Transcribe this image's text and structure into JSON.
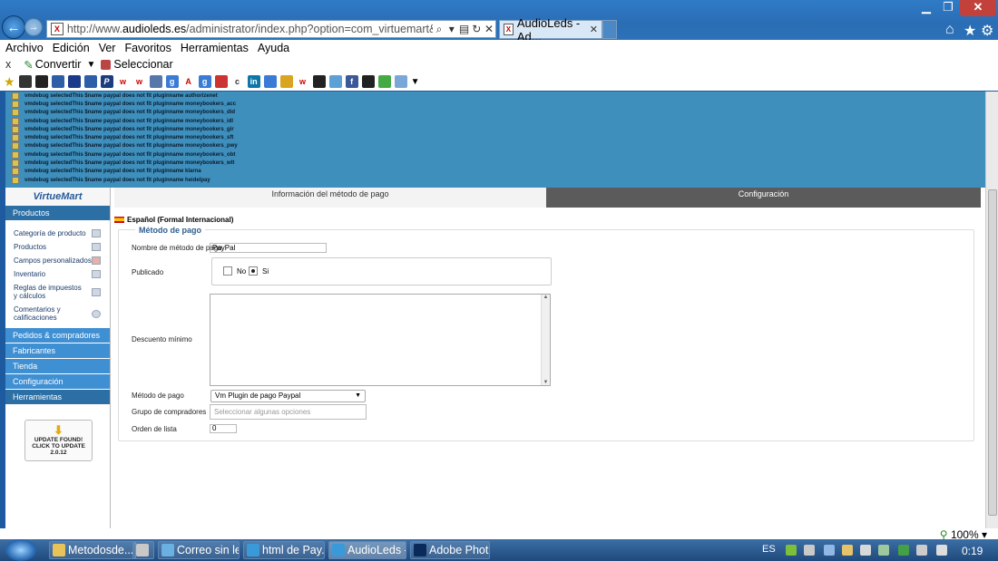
{
  "browser": {
    "url_prefix": "http://www.",
    "url_domain": "audioleds.es",
    "url_rest": "/administrator/index.php?option=com_virtuemart&view=paymen",
    "tab_title": "AudioLeds - Ad...",
    "favicon": "X"
  },
  "menubar": [
    "Archivo",
    "Edición",
    "Ver",
    "Favoritos",
    "Herramientas",
    "Ayuda"
  ],
  "cmdbar": {
    "close": "x",
    "convert": "Convertir",
    "select": "Seleccionar"
  },
  "debug_lines": [
    "vmdebug selectedThis $name paypal does not fit pluginname authorizenet",
    "vmdebug selectedThis $name paypal does not fit pluginname moneybookers_acc",
    "vmdebug selectedThis $name paypal does not fit pluginname moneybookers_did",
    "vmdebug selectedThis $name paypal does not fit pluginname moneybookers_idl",
    "vmdebug selectedThis $name paypal does not fit pluginname moneybookers_gir",
    "vmdebug selectedThis $name paypal does not fit pluginname moneybookers_sft",
    "vmdebug selectedThis $name paypal does not fit pluginname moneybookers_pwy",
    "vmdebug selectedThis $name paypal does not fit pluginname moneybookers_obt",
    "vmdebug selectedThis $name paypal does not fit pluginname moneybookers_wlt",
    "vmdebug selectedThis $name paypal does not fit pluginname klarna",
    "vmdebug selectedThis $name paypal does not fit pluginname heidelpay"
  ],
  "sidebar": {
    "logo": "VirtueMart",
    "products_header": "Productos",
    "items": [
      "Categoría de producto",
      "Productos",
      "Campos personalizados",
      "Inventario",
      "Reglas de impuestos y cálculos",
      "Comentarios y calificaciones"
    ],
    "sections": [
      "Pedidos & compradores",
      "Fabricantes",
      "Tienda",
      "Configuración",
      "Herramientas"
    ],
    "update": {
      "line1": "UPDATE FOUND!",
      "line2": "CLICK TO UPDATE",
      "version": "2.0.12"
    }
  },
  "tabs": {
    "info": "Información del método de pago",
    "config": "Configuración"
  },
  "language": "Español (Formal Internacional)",
  "form": {
    "legend": "Método de pago",
    "name_label": "Nombre de método de pago",
    "name_value": "PayPal",
    "published_label": "Publicado",
    "radio_no": "No",
    "radio_yes": "Si",
    "discount_label": "Descuento mínimo",
    "method_label": "Método de pago",
    "method_value": "Vm Plugin de pago Paypal",
    "group_label": "Grupo de compradores",
    "group_placeholder": "Seleccionar algunas opciones",
    "order_label": "Orden de lista",
    "order_value": "0"
  },
  "status": {
    "zoom": "100%"
  },
  "taskbar": {
    "tasks": [
      "Metodosde...",
      "",
      "Correo sin le...",
      "html de Pay...",
      "AudioLeds -...",
      "Adobe Phot..."
    ],
    "lang": "ES",
    "clock": "0:19"
  },
  "colors": {
    "accent": "#2c6fa5",
    "debug_bg": "#3f8fbd",
    "config_tab": "#5b5b5b"
  }
}
